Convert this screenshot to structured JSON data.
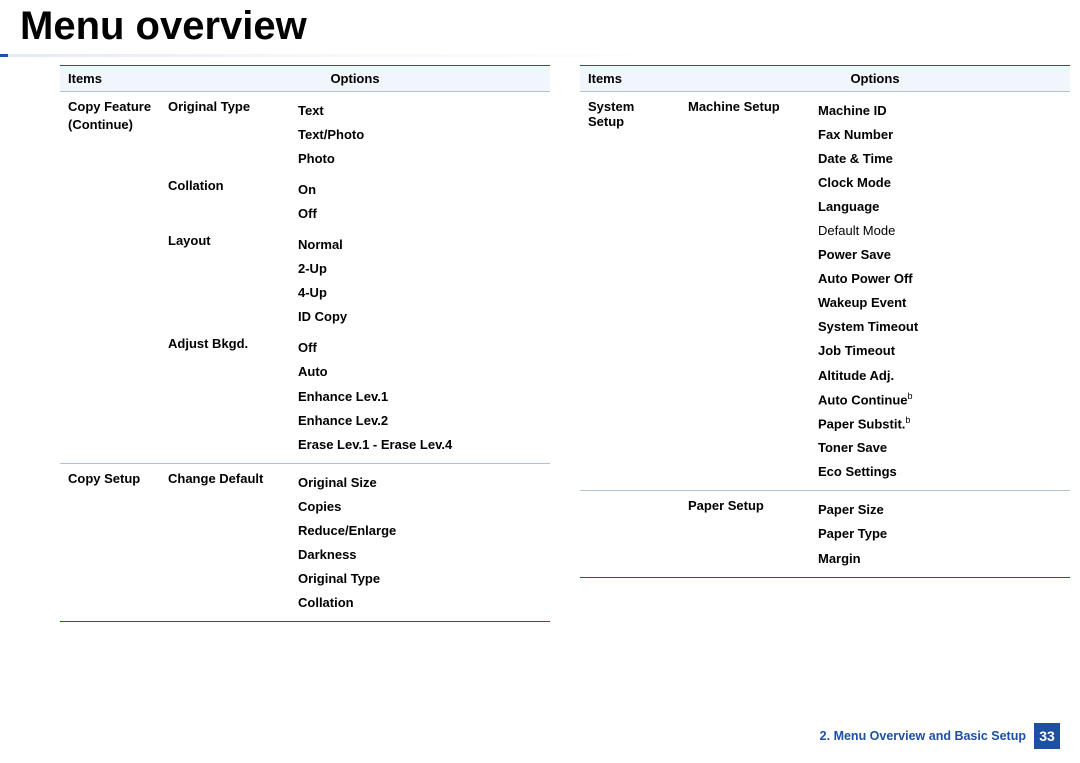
{
  "title": "Menu overview",
  "footer": {
    "section": "2. Menu Overview and Basic Setup",
    "page": "33"
  },
  "headers": {
    "items": "Items",
    "options": "Options"
  },
  "left": {
    "r1": {
      "item": "Copy Feature",
      "item2": "(Continue)",
      "sub": "Original Type",
      "opts": [
        "Text",
        "Text/Photo",
        "Photo"
      ]
    },
    "r2": {
      "sub": "Collation",
      "opts": [
        "On",
        "Off"
      ]
    },
    "r3": {
      "sub": "Layout",
      "opts": [
        "Normal",
        "2-Up",
        "4-Up",
        "ID Copy"
      ]
    },
    "r4": {
      "sub": "Adjust Bkgd.",
      "opts": [
        "Off",
        "Auto",
        "Enhance Lev.1",
        "Enhance Lev.2",
        "Erase Lev.1 - Erase Lev.4"
      ]
    },
    "r5": {
      "item": "Copy Setup",
      "sub": "Change Default",
      "opts": [
        "Original Size",
        "Copies",
        "Reduce/Enlarge",
        "Darkness",
        "Original Type",
        "Collation"
      ]
    }
  },
  "right": {
    "r1": {
      "item": "System Setup",
      "sub": "Machine Setup",
      "opts": [
        "Machine ID",
        "Fax Number",
        "Date & Time",
        "Clock Mode",
        "Language"
      ],
      "nonbold": "Default Mode",
      "opts2": [
        "Power Save",
        "Auto Power Off",
        "Wakeup Event",
        "System Timeout",
        "Job Timeout",
        "Altitude Adj."
      ],
      "sup1": "Auto Continue",
      "supchar1": "b",
      "sup2": "Paper Substit.",
      "supchar2": "b",
      "opts3": [
        "Toner Save",
        "Eco Settings"
      ]
    },
    "r2": {
      "sub": "Paper Setup",
      "opts": [
        "Paper Size",
        "Paper Type",
        "Margin"
      ]
    }
  }
}
